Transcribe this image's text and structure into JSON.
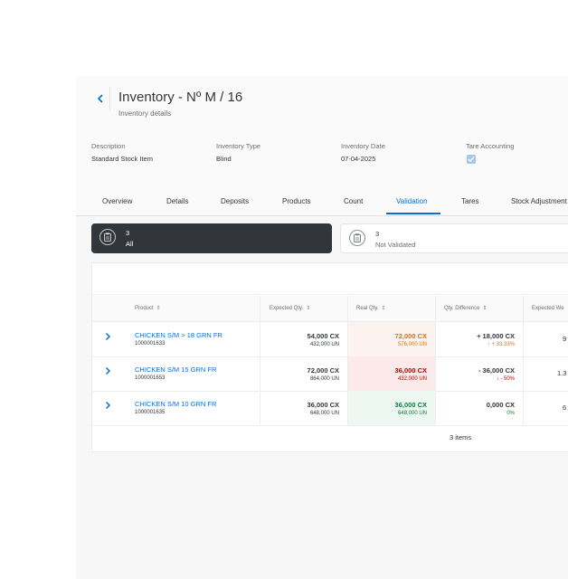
{
  "header": {
    "back_icon": "chevron-left-icon",
    "title": "Inventory - Nº M / 16",
    "subtitle": "Inventory details"
  },
  "info": {
    "description_label": "Description",
    "description_value": "Standard Stock Item",
    "type_label": "Inventory Type",
    "type_value": "Blind",
    "date_label": "Inventory Date",
    "date_value": "07-04-2025",
    "tare_label": "Tare Accounting",
    "tare_checked": true
  },
  "tabs": [
    "Overview",
    "Details",
    "Deposits",
    "Products",
    "Count",
    "Validation",
    "Tares",
    "Stock Adjustment"
  ],
  "active_tab": "Validation",
  "filters": [
    {
      "count": "3",
      "label": "All",
      "icon": "clipboard-icon"
    },
    {
      "count": "3",
      "label": "Not Validated",
      "icon": "clipboard-icon"
    }
  ],
  "table": {
    "columns": {
      "product": "Product",
      "expected_qty": "Expected Qty.",
      "real_qty": "Real Qty.",
      "qty_difference": "Qty. Difference",
      "expected_weight": "Expected We"
    },
    "sort_icon": "sort-icon",
    "rows": [
      {
        "name": "CHICKEN S/M > 18 GRN FR",
        "code": "1000001633",
        "expected_main": "54,000 CX",
        "expected_sub": "432,000 UN",
        "real_main": "72,000 CX",
        "real_sub": "576,000 UN",
        "diff_main": "+ 18,000 CX",
        "diff_sub": "↑ + 33.33%",
        "expected_weight": "9",
        "status": "over"
      },
      {
        "name": "CHICKEN S/M 15 GRN FR",
        "code": "1000001653",
        "expected_main": "72,000 CX",
        "expected_sub": "864,000 UN",
        "real_main": "36,000 CX",
        "real_sub": "432,000 UN",
        "diff_main": "- 36,000 CX",
        "diff_sub": "↓ - 50%",
        "expected_weight": "1.3",
        "status": "under"
      },
      {
        "name": "CHICKEN S/M 10 GRN FR",
        "code": "1000001635",
        "expected_main": "36,000 CX",
        "expected_sub": "648,000 UN",
        "real_main": "36,000 CX",
        "real_sub": "648,000 UN",
        "diff_main": "0,000 CX",
        "diff_sub": "0%",
        "expected_weight": "6",
        "status": "match"
      }
    ],
    "items_count": "3 items"
  },
  "colors": {
    "accent": "#0a6ed1",
    "over_bg": "#fdf3ee",
    "over_text": "#df6e0c",
    "under_bg": "#fce9ea",
    "under_text": "#bb0000",
    "match_bg": "#eef8f2",
    "match_text": "#107e3e"
  }
}
